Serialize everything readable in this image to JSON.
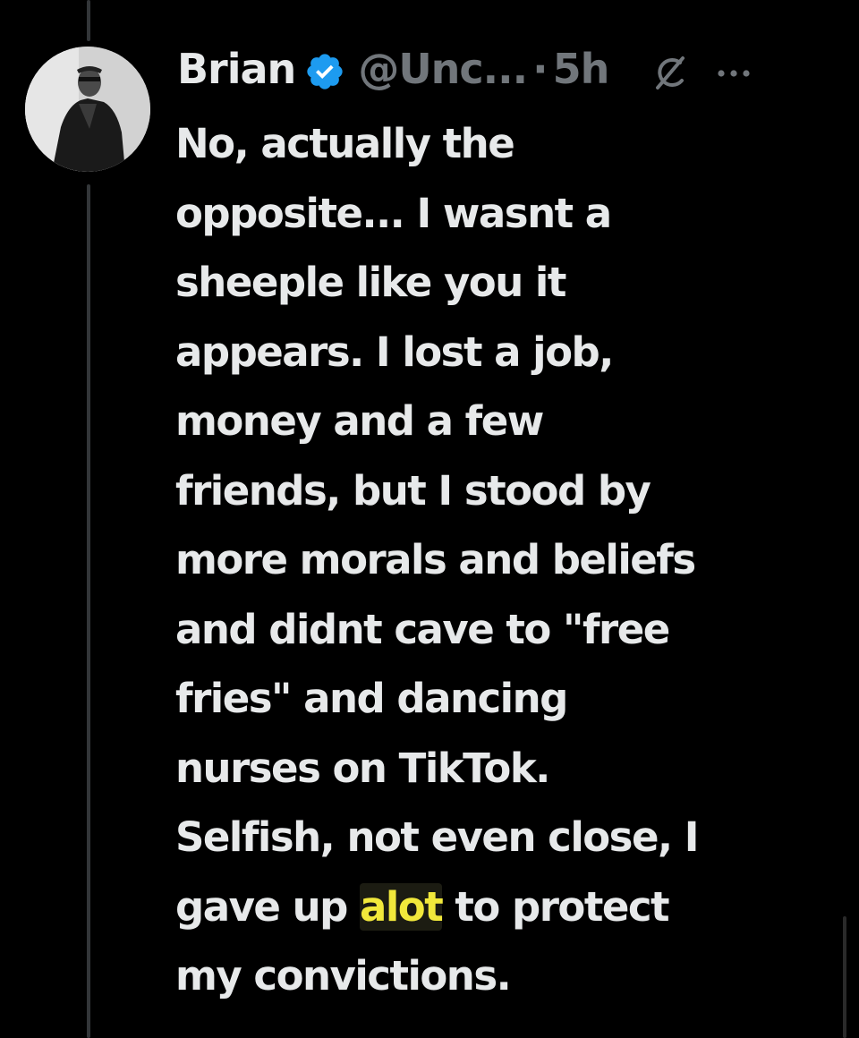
{
  "tweet": {
    "author_name": "Brian",
    "author_handle": "@Unc...",
    "separator": "·",
    "timestamp": "5h",
    "text_lines": [
      "No, actually the",
      "opposite... I wasnt a",
      "sheeple like you it",
      "appears. I lost a job,",
      "money and a few",
      "friends, but I stood by",
      "more morals and beliefs",
      "and didnt cave to \"free",
      "fries\" and dancing",
      "nurses on TikTok.",
      "Selfish, not even close, I"
    ],
    "line_12_before": "gave up ",
    "line_12_highlight": "alot",
    "line_12_after": " to protect",
    "line_13": "my convictions."
  },
  "icons": {
    "verified": "verified-badge-icon",
    "grok": "grok-icon",
    "more": "more-options-icon"
  },
  "colors": {
    "background": "#000000",
    "text": "#e7e9ea",
    "muted": "#71767b",
    "verified_blue": "#1d9bf0",
    "highlight_text": "#f1e83b",
    "thread_line": "#333639"
  }
}
